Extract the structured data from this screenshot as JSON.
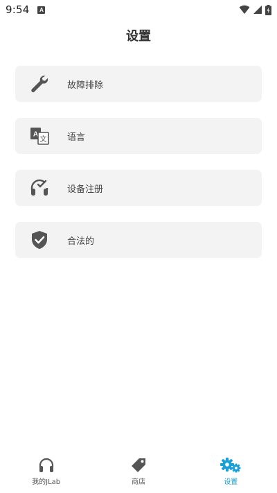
{
  "status_bar": {
    "time": "9:54",
    "notification_letter": "A",
    "battery_glyph": "ϟ"
  },
  "header": {
    "title": "设置"
  },
  "settings": {
    "items": [
      {
        "label": "故障排除",
        "icon": "wrench-icon"
      },
      {
        "label": "语言",
        "icon": "translate-icon"
      },
      {
        "label": "设备注册",
        "icon": "headphones-check-icon"
      },
      {
        "label": "合法的",
        "icon": "shield-check-icon"
      }
    ]
  },
  "bottom_nav": {
    "items": [
      {
        "label": "我的JLab",
        "icon": "headphones-icon",
        "active": false
      },
      {
        "label": "商店",
        "icon": "tag-icon",
        "active": false
      },
      {
        "label": "设置",
        "icon": "gears-icon",
        "active": true
      }
    ]
  },
  "colors": {
    "accent": "#1aa0d8",
    "card_bg": "#f3f3f3",
    "icon_gray": "#555555"
  }
}
